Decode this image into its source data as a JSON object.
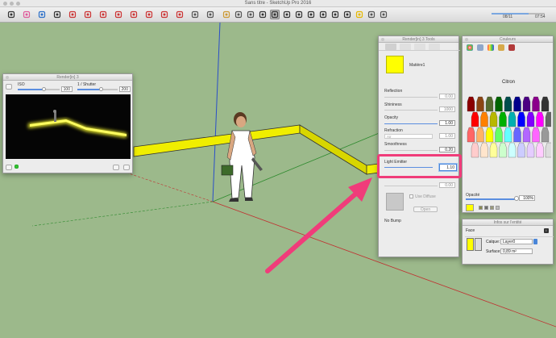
{
  "app": {
    "title": "Sans titre - SketchUp Pro 2016"
  },
  "toolbar": {
    "time_left": "08/11",
    "time_right": "07:54",
    "tools": [
      "select",
      "eraser",
      "paint",
      "line",
      "arc",
      "shape",
      "push-pull",
      "move",
      "rotate",
      "scale",
      "offset",
      "follow-me",
      "tape",
      "text",
      "axes",
      "dimension",
      "protractor",
      "section",
      "orbit",
      "pan",
      "zoom",
      "zoom-extents",
      "walk",
      "look",
      "position",
      "render",
      "views",
      "shadow"
    ]
  },
  "render_window": {
    "title": "Render[in] 3",
    "iso_label": "ISO",
    "iso_value": "100",
    "iso_fill": 0.63,
    "shutter_label": "1 / Shutter",
    "shutter_value": "200",
    "shutter_fill": 0.6
  },
  "material_panel": {
    "title": "Render[in] 3 Tools",
    "material_name": "Matière1",
    "reflection_label": "Reflection",
    "reflection_value": "0.00",
    "shininess_label": "Shininess",
    "shininess_value": "1000",
    "opacity_label": "Opacity",
    "opacity_value": "1.00",
    "refraction_label": "Refraction",
    "refraction_select": "Air",
    "refraction_value": "1.00",
    "smoothness_label": "Smoothness",
    "smoothness_value": "0.20",
    "light_emitter_label": "Light Emitter",
    "light_emitter_value": "1.10",
    "extra_value": "0.00",
    "use_diffuse_label": "Use Diffuse",
    "open_label": "Open",
    "no_bump_label": "No Bump"
  },
  "colours_panel": {
    "title": "Couleurs",
    "color_name": "Citron",
    "opacity_label": "Opacité",
    "opacity_value": "100%",
    "current_color": "#ffff00"
  },
  "entity_panel": {
    "title": "Infos sur l'entité",
    "type": "Face",
    "layer_label": "Calque:",
    "layer_value": "Layer0",
    "area_label": "Surface:",
    "area_value": "0,89 m²"
  },
  "colors": {
    "highlight": "#f03c7a",
    "material": "#ffff00",
    "scene_bg": "#9cb98b"
  }
}
